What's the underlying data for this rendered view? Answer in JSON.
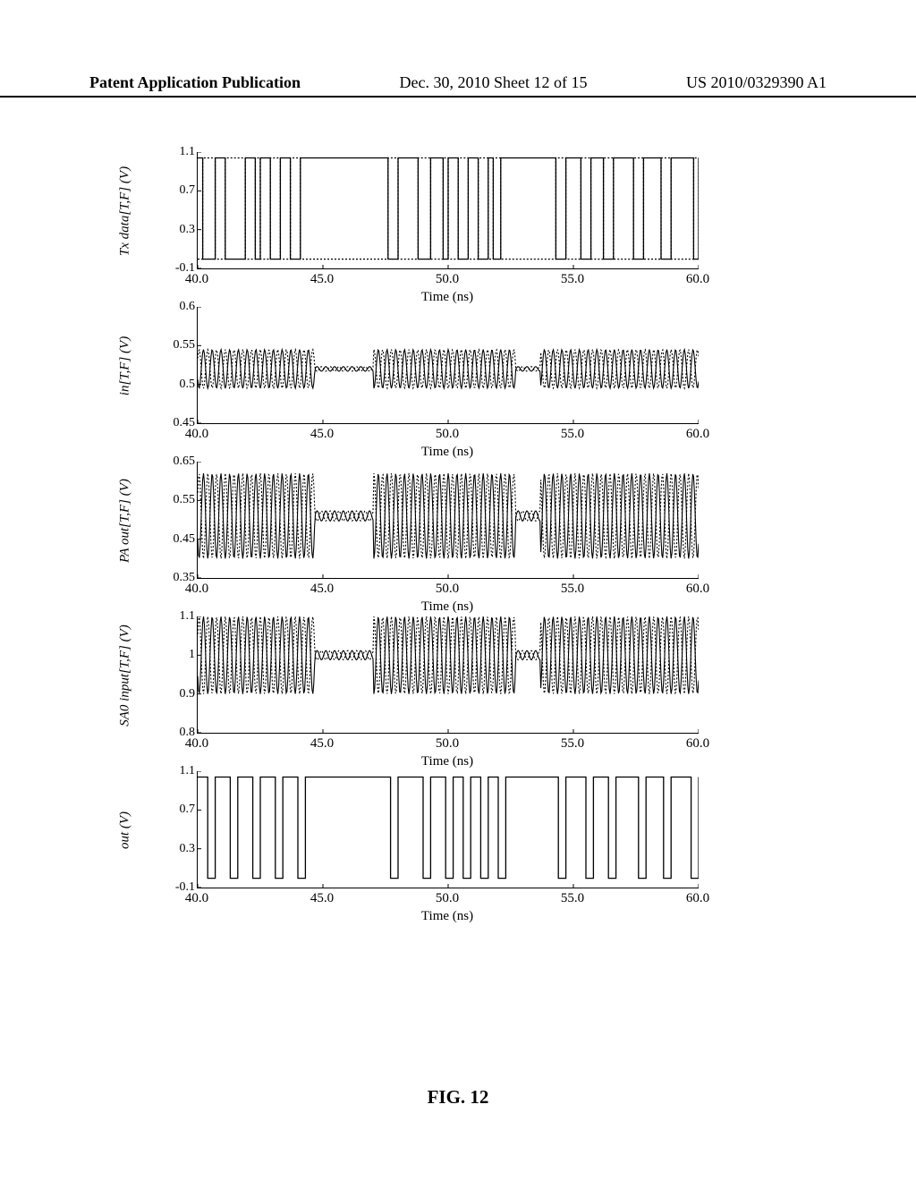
{
  "header": {
    "left": "Patent Application Publication",
    "middle": "Dec. 30, 2010   Sheet 12 of 15",
    "right": "US 2010/0329390 A1"
  },
  "figure_caption": "FIG. 12",
  "chart_data": [
    {
      "type": "line",
      "title": "",
      "ylabel": "Tx data[T,F] (V)",
      "xlabel": "Time (ns)",
      "xlim": [
        40.0,
        60.0
      ],
      "ylim": [
        -0.1,
        1.1
      ],
      "xticks": [
        40.0,
        45.0,
        50.0,
        55.0,
        60.0
      ],
      "yticks": [
        -0.1,
        0.3,
        0.7,
        1.1
      ],
      "series": [
        {
          "name": "T",
          "color": "#000",
          "edges": [
            [
              40.0,
              1
            ],
            [
              40.2,
              0
            ],
            [
              40.7,
              1
            ],
            [
              41.1,
              0
            ],
            [
              41.9,
              1
            ],
            [
              42.3,
              0
            ],
            [
              42.5,
              1
            ],
            [
              42.9,
              0
            ],
            [
              43.3,
              1
            ],
            [
              43.7,
              0
            ],
            [
              44.1,
              1
            ],
            [
              47.6,
              0
            ],
            [
              48.0,
              1
            ],
            [
              48.8,
              0
            ],
            [
              49.3,
              1
            ],
            [
              49.8,
              0
            ],
            [
              50.0,
              1
            ],
            [
              50.4,
              0
            ],
            [
              50.8,
              1
            ],
            [
              51.2,
              0
            ],
            [
              51.6,
              1
            ],
            [
              51.8,
              0
            ],
            [
              52.1,
              1
            ],
            [
              54.3,
              0
            ],
            [
              54.7,
              1
            ],
            [
              55.3,
              0
            ],
            [
              55.7,
              1
            ],
            [
              56.2,
              0
            ],
            [
              56.6,
              1
            ],
            [
              57.4,
              0
            ],
            [
              57.8,
              1
            ],
            [
              58.5,
              0
            ],
            [
              58.9,
              1
            ],
            [
              59.8,
              0
            ],
            [
              60.0,
              1
            ]
          ]
        },
        {
          "name": "F",
          "color": "#000",
          "dash": [
            2,
            2
          ],
          "edges": [
            [
              40.0,
              0
            ],
            [
              40.2,
              1
            ],
            [
              40.7,
              0
            ],
            [
              41.1,
              1
            ],
            [
              41.9,
              0
            ],
            [
              42.3,
              1
            ],
            [
              42.5,
              0
            ],
            [
              42.9,
              1
            ],
            [
              43.3,
              0
            ],
            [
              43.7,
              1
            ],
            [
              44.1,
              0
            ],
            [
              47.6,
              1
            ],
            [
              48.0,
              0
            ],
            [
              48.8,
              1
            ],
            [
              49.3,
              0
            ],
            [
              49.8,
              1
            ],
            [
              50.0,
              0
            ],
            [
              50.4,
              1
            ],
            [
              50.8,
              0
            ],
            [
              51.2,
              1
            ],
            [
              51.6,
              0
            ],
            [
              51.8,
              1
            ],
            [
              52.1,
              0
            ],
            [
              54.3,
              1
            ],
            [
              54.7,
              0
            ],
            [
              55.3,
              1
            ],
            [
              55.7,
              0
            ],
            [
              56.2,
              1
            ],
            [
              56.6,
              0
            ],
            [
              57.4,
              1
            ],
            [
              57.8,
              0
            ],
            [
              58.5,
              1
            ],
            [
              58.9,
              0
            ],
            [
              59.8,
              1
            ],
            [
              60.0,
              0
            ]
          ]
        }
      ]
    },
    {
      "type": "line",
      "ylabel": "in[T,F] (V)",
      "xlabel": "Time (ns)",
      "xlim": [
        40.0,
        60.0
      ],
      "ylim": [
        0.45,
        0.6
      ],
      "xticks": [
        40.0,
        45.0,
        50.0,
        55.0,
        60.0
      ],
      "yticks": [
        0.45,
        0.5,
        0.55,
        0.6
      ],
      "burst_level": [
        0.5,
        0.55
      ],
      "baseline": 0.52
    },
    {
      "type": "line",
      "ylabel": "PA out[T,F] (V)",
      "xlabel": "Time (ns)",
      "xlim": [
        40.0,
        60.0
      ],
      "ylim": [
        0.35,
        0.65
      ],
      "xticks": [
        40.0,
        45.0,
        50.0,
        55.0,
        60.0
      ],
      "yticks": [
        0.35,
        0.45,
        0.55,
        0.65
      ],
      "burst_level": [
        0.4,
        0.62
      ],
      "baseline": 0.51
    },
    {
      "type": "line",
      "ylabel": "SA0 input[T,F] (V)",
      "xlabel": "Time (ns)",
      "xlim": [
        40.0,
        60.0
      ],
      "ylim": [
        0.8,
        1.1
      ],
      "xticks": [
        40.0,
        45.0,
        50.0,
        55.0,
        60.0
      ],
      "yticks": [
        0.8,
        0.9,
        1.0,
        1.1
      ],
      "burst_level": [
        0.9,
        1.1
      ],
      "baseline": 1.0
    },
    {
      "type": "line",
      "ylabel": "out (V)",
      "xlabel": "Time (ns)",
      "xlim": [
        40.0,
        60.0
      ],
      "ylim": [
        -0.1,
        1.1
      ],
      "xticks": [
        40.0,
        45.0,
        50.0,
        55.0,
        60.0
      ],
      "yticks": [
        -0.1,
        0.3,
        0.7,
        1.1
      ],
      "series": [
        {
          "name": "out",
          "color": "#000",
          "edges": [
            [
              40.0,
              1
            ],
            [
              40.4,
              0
            ],
            [
              40.7,
              1
            ],
            [
              41.3,
              0
            ],
            [
              41.6,
              1
            ],
            [
              42.2,
              0
            ],
            [
              42.5,
              1
            ],
            [
              43.1,
              0
            ],
            [
              43.4,
              1
            ],
            [
              44.0,
              0
            ],
            [
              44.3,
              1
            ],
            [
              47.7,
              0
            ],
            [
              48.0,
              1
            ],
            [
              49.0,
              0
            ],
            [
              49.3,
              1
            ],
            [
              49.9,
              0
            ],
            [
              50.2,
              1
            ],
            [
              50.6,
              0
            ],
            [
              50.9,
              1
            ],
            [
              51.3,
              0
            ],
            [
              51.6,
              1
            ],
            [
              52.0,
              0
            ],
            [
              52.3,
              1
            ],
            [
              54.4,
              0
            ],
            [
              54.7,
              1
            ],
            [
              55.5,
              0
            ],
            [
              55.8,
              1
            ],
            [
              56.4,
              0
            ],
            [
              56.7,
              1
            ],
            [
              57.6,
              0
            ],
            [
              57.9,
              1
            ],
            [
              58.6,
              0
            ],
            [
              58.9,
              1
            ],
            [
              59.7,
              0
            ],
            [
              60.0,
              1
            ]
          ]
        }
      ]
    }
  ]
}
